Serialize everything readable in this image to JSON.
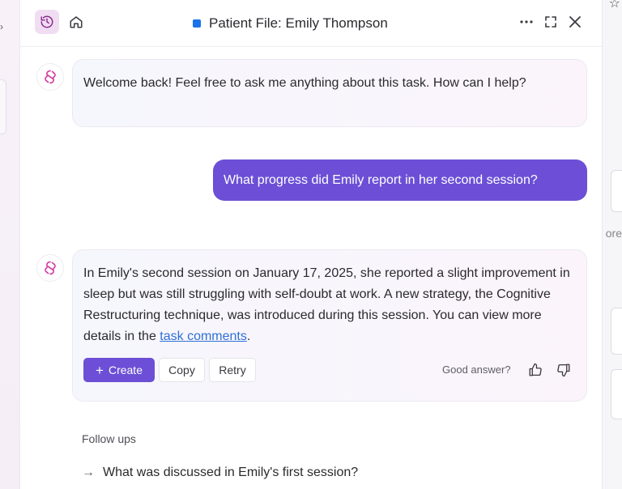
{
  "header": {
    "title": "Patient File: Emily Thompson",
    "title_color": "#1a73e8",
    "icons": [
      "history-icon",
      "home-icon",
      "more-icon",
      "expand-icon",
      "close-icon"
    ]
  },
  "messages": [
    {
      "role": "assistant",
      "text": "Welcome back! Feel free to ask me anything about this task. How can I help?"
    },
    {
      "role": "user",
      "text": "What progress did Emily report in her second session?"
    },
    {
      "role": "assistant",
      "text_before": "In Emily's second session on January 17, 2025, she reported a slight improvement in sleep but was still struggling with self-doubt at work. A new strategy, the Cognitive Restructuring technique, was introduced during this session. You can view more details in the ",
      "link_text": "task comments",
      "text_after": "."
    }
  ],
  "actions": {
    "create_label": "Create",
    "copy_label": "Copy",
    "retry_label": "Retry",
    "feedback_prompt": "Good answer?"
  },
  "followups": {
    "label": "Follow ups",
    "items": [
      "What was discussed in Emily's first session?"
    ]
  },
  "background": {
    "right_text": "ore"
  },
  "colors": {
    "accent": "#6c4fd6",
    "link": "#2f6fd6"
  }
}
